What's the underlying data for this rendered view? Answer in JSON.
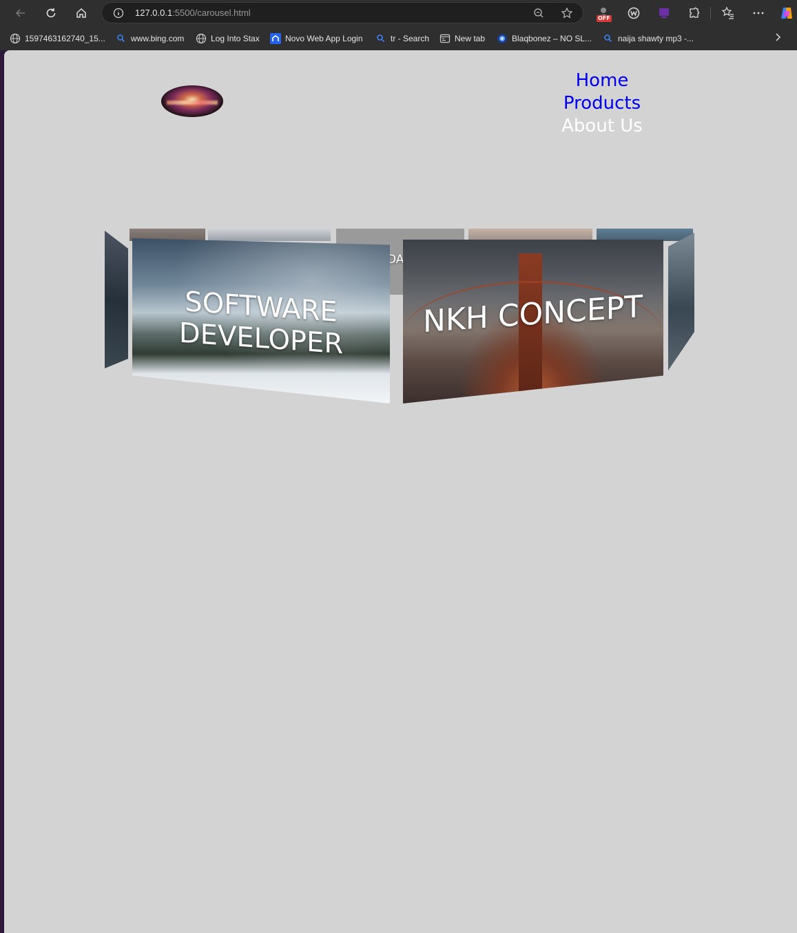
{
  "browser": {
    "url_host": "127.0.0.1",
    "url_path": ":5500/carousel.html",
    "extension_badge": "OFF",
    "bookmarks": [
      {
        "label": "1597463162740_15...",
        "icon": "globe-icon"
      },
      {
        "label": "www.bing.com",
        "icon": "search-icon"
      },
      {
        "label": "Log Into Stax",
        "icon": "globe-icon"
      },
      {
        "label": "Novo Web App Login",
        "icon": "novo-icon"
      },
      {
        "label": "tr - Search",
        "icon": "search-icon"
      },
      {
        "label": "New tab",
        "icon": "newtab-icon"
      },
      {
        "label": "Blaqbonez – NO SL...",
        "icon": "site-icon"
      },
      {
        "label": "naija shawty mp3 -...",
        "icon": "search-icon"
      }
    ]
  },
  "page": {
    "nav": [
      "Home",
      "Products",
      "About Us"
    ],
    "carousel": {
      "front_left_caption": "SOFTWARE DEVELOPER",
      "front_right_caption": "NKH CONCEPT",
      "back_center_fragment": "DA"
    }
  },
  "colors": {
    "page_bg": "#d3d3d3",
    "nav_link": "#0000ee",
    "nav_active": "#ffffff",
    "chrome_bg": "#2f2f2f"
  }
}
